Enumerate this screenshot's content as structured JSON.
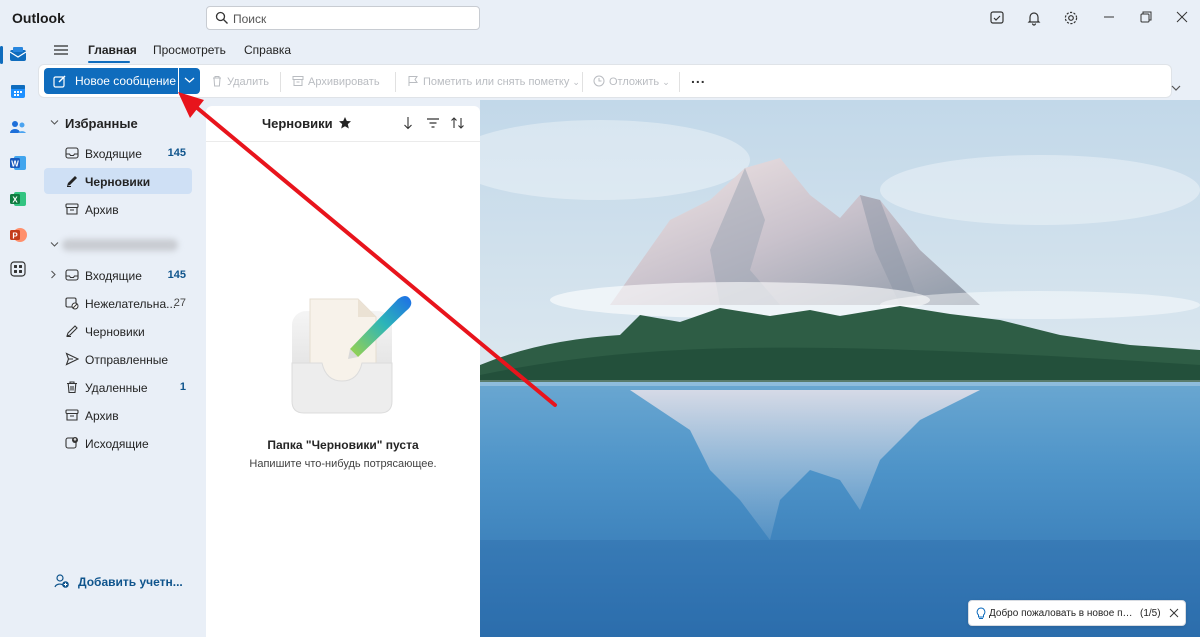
{
  "app": {
    "title": "Outlook"
  },
  "search": {
    "placeholder": "Поиск"
  },
  "titlebar_icons": [
    "my-day-icon",
    "bell-icon",
    "gear-icon",
    "minimize-icon",
    "restore-icon",
    "close-icon"
  ],
  "rail": [
    "mail-icon",
    "calendar-icon",
    "people-icon",
    "word-icon",
    "excel-icon",
    "powerpoint-icon",
    "apps-icon"
  ],
  "ribbon": {
    "tabs": [
      {
        "label": "Главная",
        "active": true
      },
      {
        "label": "Просмотреть",
        "active": false
      },
      {
        "label": "Справка",
        "active": false
      }
    ],
    "new_message": "Новое сообщение",
    "tools": {
      "delete": "Удалить",
      "archive": "Архивировать",
      "flag": "Пометить или снять пометку",
      "snooze": "Отложить",
      "more": "..."
    }
  },
  "folders": {
    "favorites_header": "Избранные",
    "favorites": [
      {
        "label": "Входящие",
        "count": "145",
        "icon": "inbox-icon"
      },
      {
        "label": "Черновики",
        "count": "",
        "icon": "pencil-icon",
        "selected": true
      },
      {
        "label": "Архив",
        "count": "",
        "icon": "archive-icon"
      }
    ],
    "account": [
      {
        "label": "Входящие",
        "count": "145",
        "icon": "inbox-icon"
      },
      {
        "label": "Нежелательна...",
        "count": "27",
        "icon": "junk-icon"
      },
      {
        "label": "Черновики",
        "count": "",
        "icon": "pencil-icon"
      },
      {
        "label": "Отправленные",
        "count": "",
        "icon": "send-icon"
      },
      {
        "label": "Удаленные",
        "count": "1",
        "icon": "trash-icon"
      },
      {
        "label": "Архив",
        "count": "",
        "icon": "archive-icon"
      },
      {
        "label": "Исходящие",
        "count": "",
        "icon": "outbox-icon"
      }
    ],
    "add_account": "Добавить учетн..."
  },
  "message_list": {
    "title": "Черновики",
    "empty_title": "Папка \"Черновики\" пуста",
    "empty_subtitle": "Напишите что-нибудь потрясающее."
  },
  "tip": {
    "text": "Добро пожаловать в новое приложение Outlook",
    "page": "(1/5)"
  },
  "colors": {
    "accent": "#0f6cbd",
    "annotation_arrow": "#e8141c"
  }
}
